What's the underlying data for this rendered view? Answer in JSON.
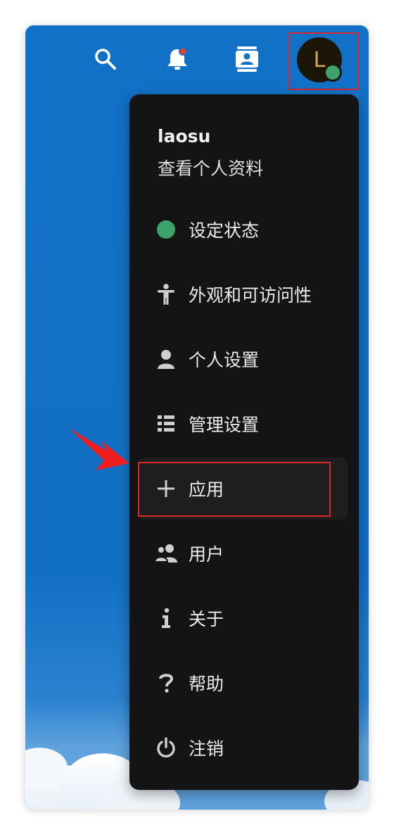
{
  "header": {
    "icons": [
      "search-icon",
      "bell-icon",
      "contacts-icon"
    ],
    "notification_dot_color": "#e0413a",
    "avatar": {
      "initial": "L",
      "status_color": "#3ca46b"
    }
  },
  "menu": {
    "profile": {
      "name": "laosu",
      "link": "查看个人资料"
    },
    "items": [
      {
        "label": "设定状态",
        "icon": "status-dot-icon"
      },
      {
        "label": "外观和可访问性",
        "icon": "accessibility-icon"
      },
      {
        "label": "个人设置",
        "icon": "person-icon"
      },
      {
        "label": "管理设置",
        "icon": "list-icon"
      },
      {
        "label": "应用",
        "icon": "plus-icon"
      },
      {
        "label": "用户",
        "icon": "users-icon"
      },
      {
        "label": "关于",
        "icon": "info-icon"
      },
      {
        "label": "帮助",
        "icon": "help-icon"
      },
      {
        "label": "注销",
        "icon": "power-icon"
      }
    ]
  },
  "annotation_color": "#d9262d"
}
